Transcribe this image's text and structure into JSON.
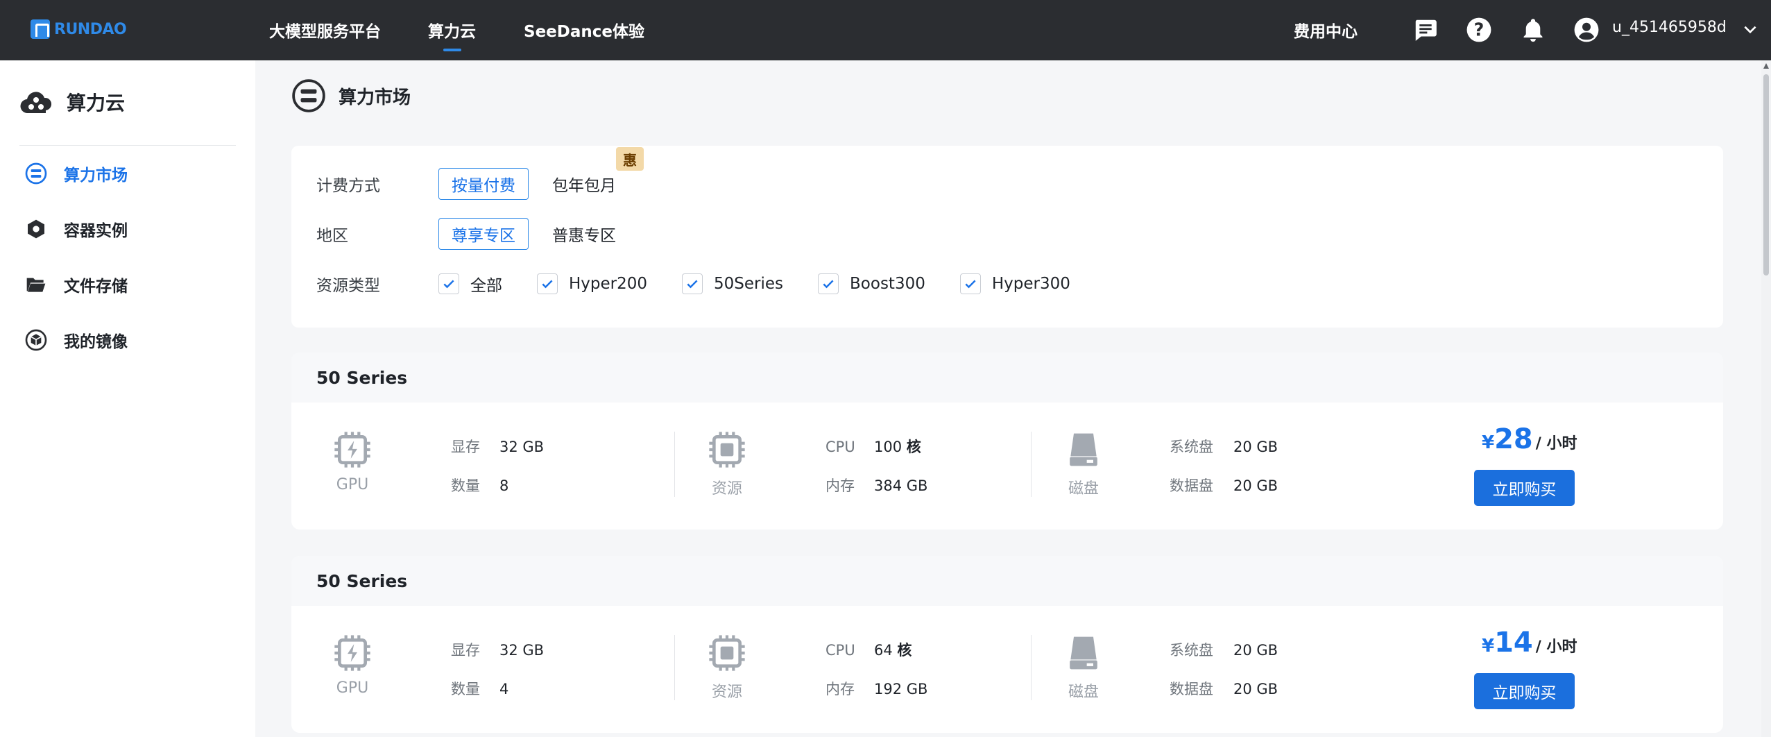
{
  "topbar": {
    "logo_text": "RUNDAO",
    "nav": [
      {
        "label": "大模型服务平台"
      },
      {
        "label": "算力云"
      },
      {
        "label": "SeeDance体验"
      }
    ],
    "fee_center": "费用中心",
    "username": "u_451465958d"
  },
  "sidebar": {
    "title": "算力云",
    "items": [
      {
        "label": "算力市场"
      },
      {
        "label": "容器实例"
      },
      {
        "label": "文件存储"
      },
      {
        "label": "我的镜像"
      }
    ]
  },
  "page": {
    "title": "算力市场"
  },
  "filters": {
    "billing": {
      "label": "计费方式",
      "selected": "按量付费",
      "other": "包年包月",
      "badge": "惠"
    },
    "region": {
      "label": "地区",
      "selected": "尊享专区",
      "other": "普惠专区"
    },
    "resource_type": {
      "label": "资源类型",
      "options": [
        "全部",
        "Hyper200",
        "50Series",
        "Boost300",
        "Hyper300"
      ]
    }
  },
  "labels": {
    "gpu": "GPU",
    "resource": "资源",
    "disk": "磁盘",
    "vram": "显存",
    "count": "数量",
    "cpu": "CPU",
    "memory": "内存",
    "system_disk": "系统盘",
    "data_disk": "数据盘",
    "currency": "¥",
    "per_hour": "/ 小时",
    "buy": "立即购买",
    "core_unit": "核"
  },
  "products": [
    {
      "series": "50 Series",
      "vram": "32 GB",
      "count": "8",
      "cpu": "100",
      "memory": "384 GB",
      "system_disk": "20 GB",
      "data_disk": "20 GB",
      "price": "28"
    },
    {
      "series": "50 Series",
      "vram": "32 GB",
      "count": "4",
      "cpu": "64",
      "memory": "192 GB",
      "system_disk": "20 GB",
      "data_disk": "20 GB",
      "price": "14"
    }
  ],
  "colors": {
    "accent": "#1b73e8",
    "topbar": "#2b2d31",
    "badge": "#f3d9a8"
  }
}
